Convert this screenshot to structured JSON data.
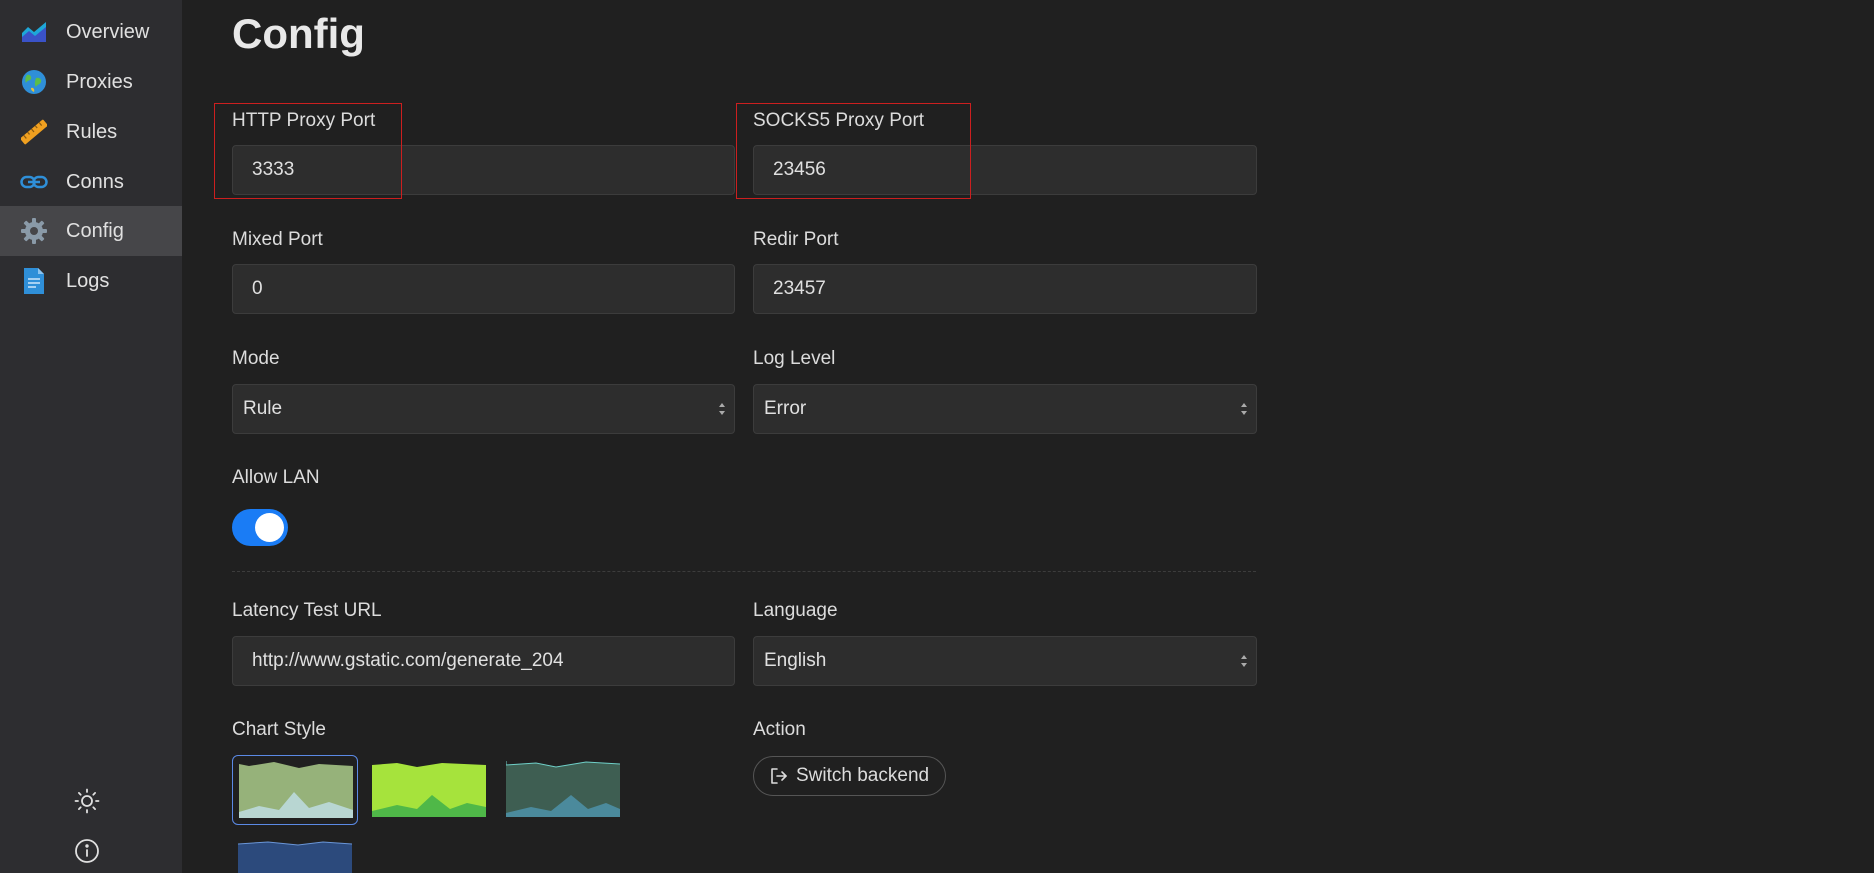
{
  "sidebar": {
    "items": [
      {
        "label": "Overview",
        "icon": "chart-area-icon"
      },
      {
        "label": "Proxies",
        "icon": "globe-icon"
      },
      {
        "label": "Rules",
        "icon": "ruler-icon"
      },
      {
        "label": "Conns",
        "icon": "link-icon"
      },
      {
        "label": "Config",
        "icon": "gear-icon",
        "active": true
      },
      {
        "label": "Logs",
        "icon": "document-icon"
      }
    ],
    "bottom_icons": [
      "sun-icon",
      "info-icon"
    ]
  },
  "page": {
    "title": "Config"
  },
  "fields": {
    "http_port": {
      "label": "HTTP Proxy Port",
      "value": "3333"
    },
    "socks_port": {
      "label": "SOCKS5 Proxy Port",
      "value": "23456"
    },
    "mixed_port": {
      "label": "Mixed Port",
      "value": "0"
    },
    "redir_port": {
      "label": "Redir Port",
      "value": "23457"
    },
    "mode": {
      "label": "Mode",
      "value": "Rule"
    },
    "log_level": {
      "label": "Log Level",
      "value": "Error"
    },
    "allow_lan": {
      "label": "Allow LAN",
      "enabled": true
    },
    "latency_url": {
      "label": "Latency Test URL",
      "value": "http://www.gstatic.com/generate_204"
    },
    "language": {
      "label": "Language",
      "value": "English"
    },
    "chart_style": {
      "label": "Chart Style",
      "selected_index": 0
    },
    "action": {
      "label": "Action",
      "button_label": "Switch backend"
    }
  },
  "colors": {
    "accent": "#1a7cf5",
    "highlight": "#cc1f1f",
    "background": "#202020",
    "sidebar": "#2d2d30"
  }
}
